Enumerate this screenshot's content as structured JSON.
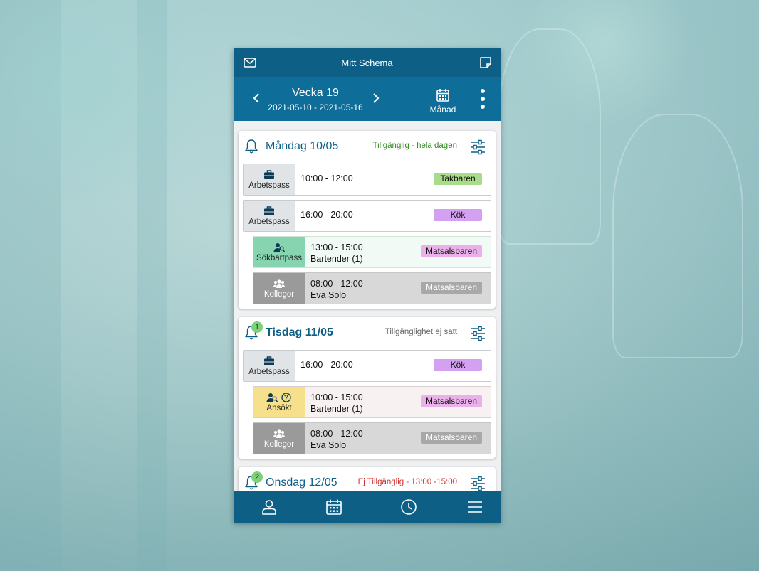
{
  "app": {
    "title": "Mitt Schema"
  },
  "week": {
    "title": "Vecka 19",
    "range": "2021-05-10 - 2021-05-16",
    "month_label": "Månad"
  },
  "days": [
    {
      "title": "Måndag 10/05",
      "availability": "Tillgänglig - hela dagen",
      "availability_color": "#2e8b1e",
      "shifts": [
        {
          "type": "Arbetspass",
          "time": "10:00 - 12:00",
          "tag": "Takbaren",
          "tag_color": "#a8dc8a"
        },
        {
          "type": "Arbetspass",
          "time": "16:00 - 20:00",
          "tag": "Kök",
          "tag_color": "#d4a0f2"
        },
        {
          "type": "Sökbartpass",
          "time": "13:00 - 15:00",
          "sub": "Bartender (1)",
          "tag": "Matsalsbaren",
          "tag_color": "#eab0ea"
        },
        {
          "type": "Kollegor",
          "time": "08:00 - 12:00",
          "sub": "Eva Solo",
          "tag": "Matsalsbaren",
          "tag_color": "#a8a8a8"
        }
      ]
    },
    {
      "title": "Tisdag 11/05",
      "badge": "1",
      "availability": "Tillgänglighet ej satt",
      "availability_color": "#666666",
      "shifts": [
        {
          "type": "Arbetspass",
          "time": "16:00 - 20:00",
          "tag": "Kök",
          "tag_color": "#d4a0f2"
        },
        {
          "type": "Ansökt",
          "time": "10:00 - 15:00",
          "sub": "Bartender (1)",
          "tag": "Matsalsbaren",
          "tag_color": "#eab0ea"
        },
        {
          "type": "Kollegor",
          "time": "08:00 - 12:00",
          "sub": "Eva Solo",
          "tag": "Matsalsbaren",
          "tag_color": "#a8a8a8"
        }
      ]
    },
    {
      "title": "Onsdag 12/05",
      "badge": "2",
      "availability": "Ej Tillgänglig - 13:00 -15:00",
      "availability_color": "#d03030"
    }
  ],
  "colors": {
    "header": "#0d5f86",
    "week_bar": "#0e6d99"
  },
  "icons": {
    "top_left": "mail-icon",
    "top_right": "note-icon",
    "nav": [
      "profile-icon",
      "calendar-icon",
      "clock-icon",
      "menu-icon"
    ]
  }
}
